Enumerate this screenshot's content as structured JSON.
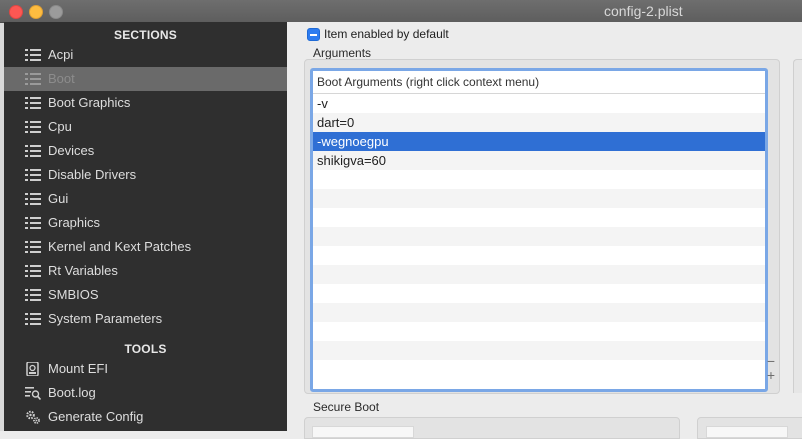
{
  "window": {
    "title": "config-2.plist"
  },
  "sidebar": {
    "sections_header": "SECTIONS",
    "items": [
      {
        "label": "Acpi",
        "icon": "list-icon"
      },
      {
        "label": "Boot",
        "icon": "list-icon",
        "selected": true
      },
      {
        "label": "Boot Graphics",
        "icon": "list-icon"
      },
      {
        "label": "Cpu",
        "icon": "list-icon"
      },
      {
        "label": "Devices",
        "icon": "list-icon"
      },
      {
        "label": "Disable Drivers",
        "icon": "list-icon"
      },
      {
        "label": "Gui",
        "icon": "list-icon"
      },
      {
        "label": "Graphics",
        "icon": "list-icon"
      },
      {
        "label": "Kernel and Kext Patches",
        "icon": "list-icon"
      },
      {
        "label": "Rt Variables",
        "icon": "list-icon"
      },
      {
        "label": "SMBIOS",
        "icon": "list-icon"
      },
      {
        "label": "System Parameters",
        "icon": "list-icon"
      }
    ],
    "tools_header": "TOOLS",
    "tools": [
      {
        "label": "Mount EFI",
        "icon": "disk-icon"
      },
      {
        "label": "Boot.log",
        "icon": "log-search-icon"
      },
      {
        "label": "Generate Config",
        "icon": "gears-icon"
      }
    ]
  },
  "main": {
    "item_enabled_label": "Item enabled by default",
    "arguments_label": "Arguments",
    "table": {
      "header": "Boot Arguments (right click context menu)",
      "rows": [
        "-v",
        "dart=0",
        "-wegnoegpu",
        "shikigva=60"
      ],
      "selected_row": "-wegnoegpu"
    },
    "minus_label": "−",
    "plus_label": "+",
    "secure_boot_label": "Secure Boot"
  },
  "colors": {
    "sidebar_bg": "#2f2f2f",
    "sidebar_selected": "#6a6a6a",
    "accent": "#2f6fd4",
    "table_focus_ring": "#7aa7e6"
  }
}
